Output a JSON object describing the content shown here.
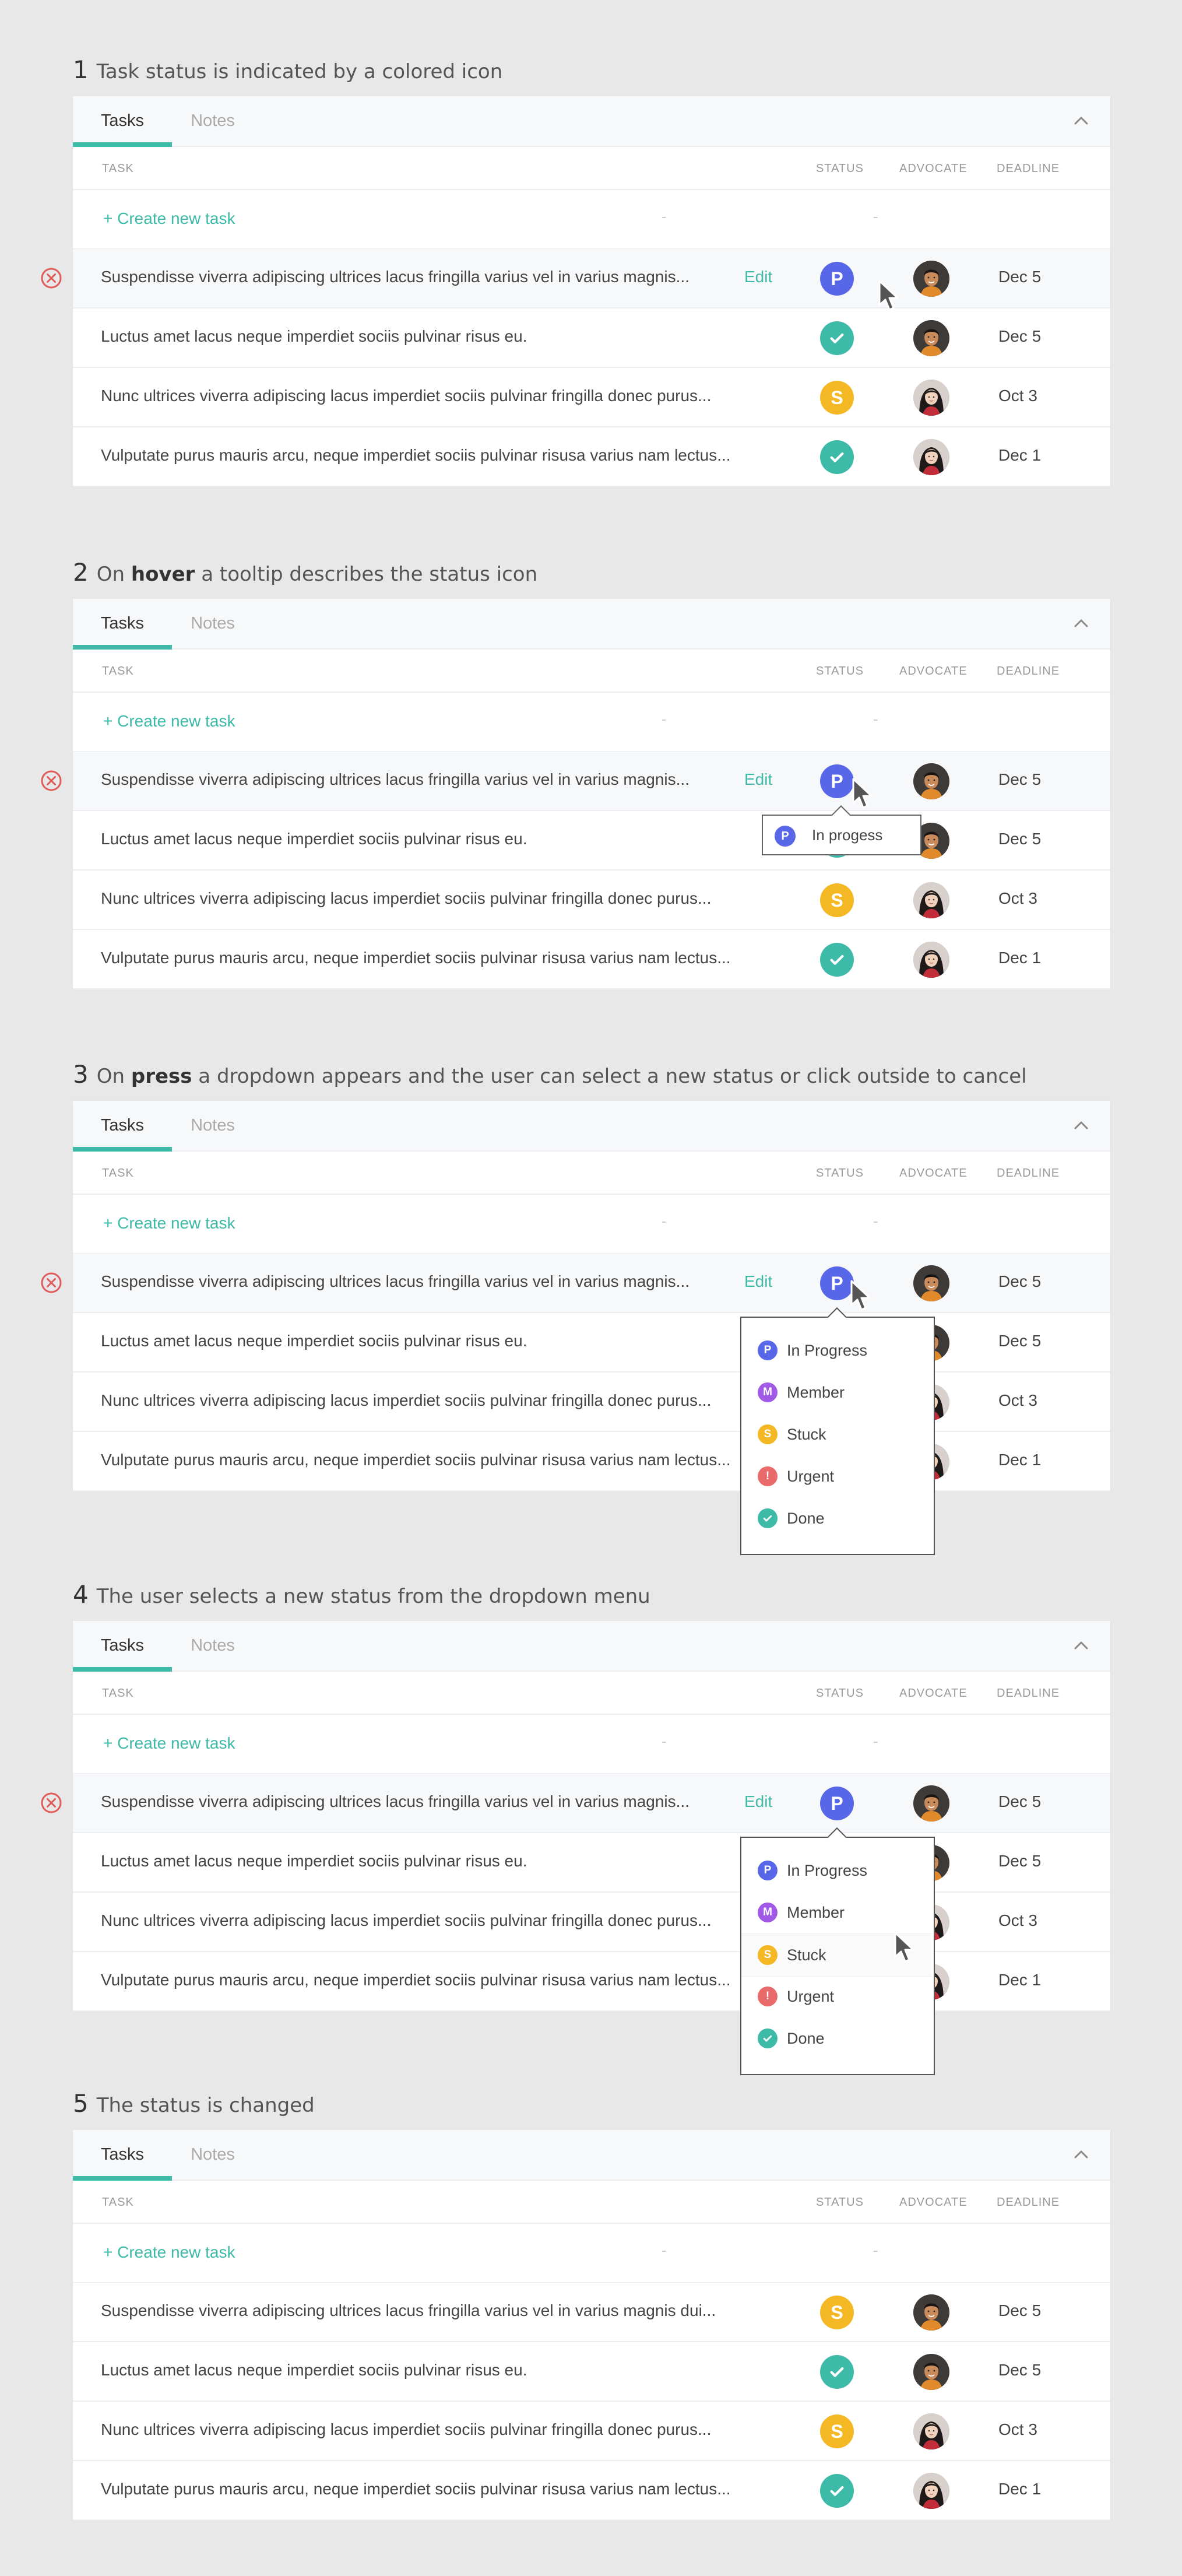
{
  "colors": {
    "accent": "#3dbaa8",
    "in_progress": "#5867e8",
    "member": "#a05ae6",
    "stuck": "#f4b824",
    "urgent": "#e86a6a",
    "done": "#3dbaa8",
    "delete": "#e05a5a"
  },
  "tabs": {
    "tasks": "Tasks",
    "notes": "Notes"
  },
  "columns": {
    "task": "TASK",
    "status": "STATUS",
    "advocate": "ADVOCATE",
    "deadline": "DEADLINE"
  },
  "create_task": "+ Create new task",
  "placeholder_dash": "-",
  "edit_label": "Edit",
  "status_letters": {
    "in_progress": "P",
    "member": "M",
    "stuck": "S",
    "urgent": "!"
  },
  "dropdown_options": [
    {
      "label": "In Progress",
      "status": "in_progress"
    },
    {
      "label": "Member",
      "status": "member"
    },
    {
      "label": "Stuck",
      "status": "stuck"
    },
    {
      "label": "Urgent",
      "status": "urgent"
    },
    {
      "label": "Done",
      "status": "done"
    }
  ],
  "steps": [
    {
      "number": "1",
      "title_html_parts": [
        "Task status is indicated by a colored icon",
        "",
        ""
      ],
      "rows": [
        {
          "text": "Suspendisse viverra adipiscing ultrices lacus fringilla  varius vel in varius magnis...",
          "status": "in_progress",
          "deadline": "Dec 5",
          "avatar": "man"
        },
        {
          "text": "Luctus amet lacus neque imperdiet sociis pulvinar risus eu.",
          "status": "done",
          "deadline": "Dec 5",
          "avatar": "man"
        },
        {
          "text": "Nunc ultrices viverra adipiscing lacus imperdiet sociis pulvinar fringilla donec purus...",
          "status": "stuck",
          "deadline": "Oct 3",
          "avatar": "woman"
        },
        {
          "text": "Vulputate purus mauris arcu, neque imperdiet sociis pulvinar risusa varius nam lectus...",
          "status": "done",
          "deadline": "Dec 1",
          "avatar": "woman"
        }
      ]
    },
    {
      "number": "2",
      "title_html_parts": [
        "On ",
        "hover",
        " a tooltip describes the status icon"
      ],
      "tooltip": "In progess",
      "rows": [
        {
          "text": "Suspendisse viverra adipiscing ultrices lacus fringilla  varius vel in varius magnis...",
          "status": "in_progress",
          "deadline": "Dec 5",
          "avatar": "man"
        },
        {
          "text": "Luctus amet lacus neque imperdiet sociis pulvinar risus eu.",
          "status": "done",
          "deadline": "Dec 5",
          "avatar": "man"
        },
        {
          "text": "Nunc ultrices viverra adipiscing lacus imperdiet sociis pulvinar fringilla donec purus...",
          "status": "stuck",
          "deadline": "Oct 3",
          "avatar": "woman"
        },
        {
          "text": "Vulputate purus mauris arcu, neque imperdiet sociis pulvinar risusa varius nam lectus...",
          "status": "done",
          "deadline": "Dec 1",
          "avatar": "woman"
        }
      ]
    },
    {
      "number": "3",
      "title_html_parts": [
        "On ",
        "press",
        " a dropdown appears and the user can select a new status or click outside to cancel"
      ],
      "rows": [
        {
          "text": "Suspendisse viverra adipiscing ultrices lacus fringilla  varius vel in varius magnis...",
          "status": "in_progress",
          "deadline": "Dec 5",
          "avatar": "man"
        },
        {
          "text": "Luctus amet lacus neque imperdiet sociis pulvinar risus eu.",
          "status": "done",
          "deadline": "Dec 5",
          "avatar": "man"
        },
        {
          "text": "Nunc ultrices viverra adipiscing lacus imperdiet sociis pulvinar fringilla donec purus...",
          "status": "stuck",
          "deadline": "Oct 3",
          "avatar": "woman"
        },
        {
          "text": "Vulputate purus mauris arcu, neque imperdiet sociis pulvinar risusa varius nam lectus...",
          "status": "done",
          "deadline": "Dec 1",
          "avatar": "woman"
        }
      ]
    },
    {
      "number": "4",
      "title_html_parts": [
        "The user selects a new status from the dropdown menu",
        "",
        ""
      ],
      "rows": [
        {
          "text": "Suspendisse viverra adipiscing ultrices lacus fringilla  varius vel in varius magnis...",
          "status": "in_progress",
          "deadline": "Dec 5",
          "avatar": "man"
        },
        {
          "text": "Luctus amet lacus neque imperdiet sociis pulvinar risus eu.",
          "status": "done",
          "deadline": "Dec 5",
          "avatar": "man"
        },
        {
          "text": "Nunc ultrices viverra adipiscing lacus imperdiet sociis pulvinar fringilla donec purus...",
          "status": "stuck",
          "deadline": "Oct 3",
          "avatar": "woman"
        },
        {
          "text": "Vulputate purus mauris arcu, neque imperdiet sociis pulvinar risusa varius nam lectus...",
          "status": "done",
          "deadline": "Dec 1",
          "avatar": "woman"
        }
      ]
    },
    {
      "number": "5",
      "title_html_parts": [
        "The status is changed",
        "",
        ""
      ],
      "rows": [
        {
          "text": "Suspendisse viverra adipiscing ultrices lacus fringilla  varius vel in varius magnis dui...",
          "status": "stuck",
          "deadline": "Dec 5",
          "avatar": "man"
        },
        {
          "text": "Luctus amet lacus neque imperdiet sociis pulvinar risus eu.",
          "status": "done",
          "deadline": "Dec 5",
          "avatar": "man"
        },
        {
          "text": "Nunc ultrices viverra adipiscing lacus imperdiet sociis pulvinar fringilla donec purus...",
          "status": "stuck",
          "deadline": "Oct 3",
          "avatar": "woman"
        },
        {
          "text": "Vulputate purus mauris arcu, neque imperdiet sociis pulvinar risusa varius nam lectus...",
          "status": "done",
          "deadline": "Dec 1",
          "avatar": "woman"
        }
      ]
    }
  ]
}
